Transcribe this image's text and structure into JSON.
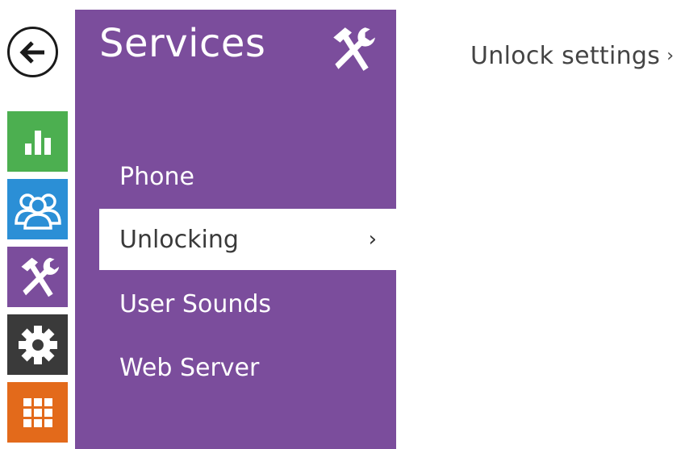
{
  "header": {
    "title": "Services",
    "title_icon": "hammer-wrench-icon"
  },
  "back_button": {
    "icon": "arrow-left-icon"
  },
  "rail": {
    "items": [
      {
        "icon": "bar-chart-icon",
        "color": "#4caf50"
      },
      {
        "icon": "users-icon",
        "color": "#2b8fd6"
      },
      {
        "icon": "hammer-wrench-icon",
        "color": "#7b4d9c"
      },
      {
        "icon": "gear-icon",
        "color": "#3a3a3a"
      },
      {
        "icon": "grid-icon",
        "color": "#e36a1b"
      }
    ]
  },
  "menu": {
    "items": [
      {
        "label": "Phone",
        "active": false
      },
      {
        "label": "Unlocking",
        "active": true,
        "chevron": "›"
      },
      {
        "label": "User Sounds",
        "active": false
      },
      {
        "label": "Web Server",
        "active": false
      }
    ]
  },
  "content": {
    "link_label": "Unlock settings",
    "link_chevron": "›"
  },
  "colors": {
    "panel": "#7b4d9c",
    "text_dark": "#444444"
  }
}
